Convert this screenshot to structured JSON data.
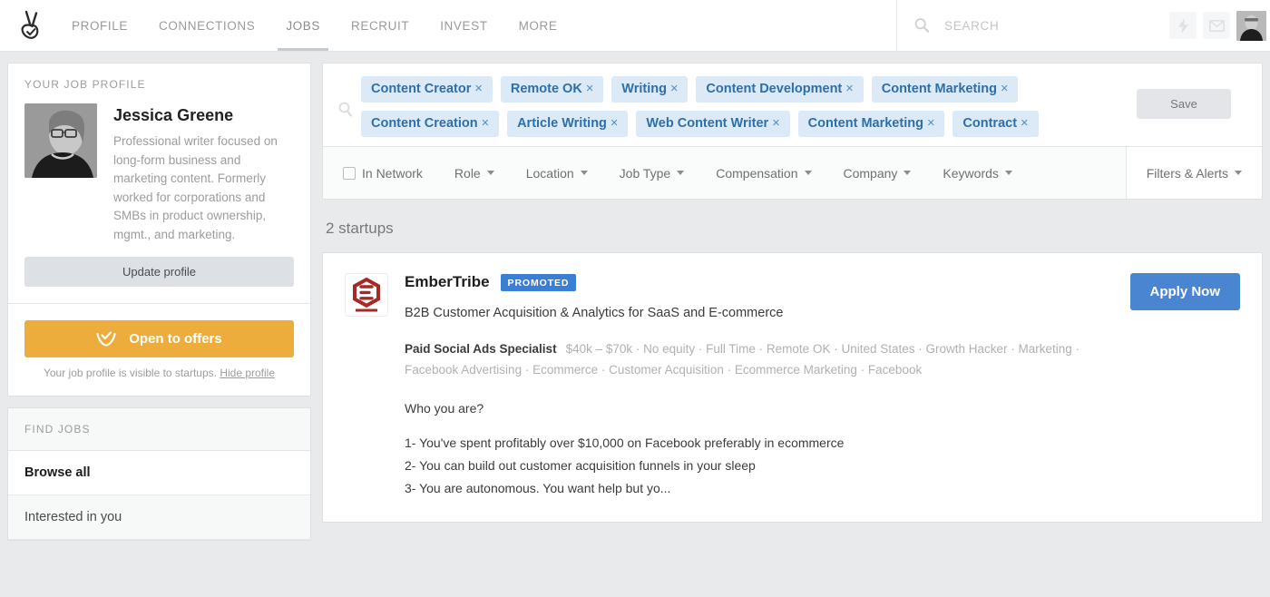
{
  "nav": {
    "logo_icon": "angellist-logo-icon",
    "items": [
      {
        "label": "PROFILE",
        "active": false
      },
      {
        "label": "CONNECTIONS",
        "active": false
      },
      {
        "label": "JOBS",
        "active": true
      },
      {
        "label": "RECRUIT",
        "active": false
      },
      {
        "label": "INVEST",
        "active": false
      },
      {
        "label": "MORE",
        "active": false
      }
    ],
    "search_placeholder": "SEARCH",
    "search_value": "",
    "search_icon": "search-icon",
    "bolt_icon": "lightning-bolt-icon",
    "mail_icon": "envelope-icon",
    "avatar": "user-avatar"
  },
  "sidebar": {
    "profile": {
      "kicker": "YOUR JOB PROFILE",
      "name": "Jessica Greene",
      "bio": "Professional writer focused on long-form business and marketing content. Formerly worked for corporations and SMBs in product ownership, mgmt., and marketing.",
      "update_label": "Update profile",
      "offers_label": "Open to offers",
      "offers_icon": "inbox-check-icon",
      "visibility_note": "Your job profile is visible to startups.",
      "hide_link": "Hide profile"
    },
    "find_jobs": {
      "heading": "FIND JOBS",
      "items": [
        {
          "label": "Browse all",
          "active": true
        },
        {
          "label": "Interested in you",
          "active": false
        }
      ]
    }
  },
  "search_panel": {
    "search_icon": "search-icon",
    "save_label": "Save",
    "tags": [
      "Content Creator",
      "Remote OK",
      "Writing",
      "Content Development",
      "Content Marketing",
      "Content Creation",
      "Article Writing",
      "Web Content Writer",
      "Content Marketing",
      "Contract"
    ],
    "tag_remove_glyph": "×"
  },
  "filters": {
    "in_network_label": "In Network",
    "in_network_checked": false,
    "dropdowns": [
      "Role",
      "Location",
      "Job Type",
      "Compensation",
      "Company",
      "Keywords"
    ],
    "right_label": "Filters & Alerts"
  },
  "results": {
    "count_label": "2 startups",
    "jobs": [
      {
        "company": "EmberTribe",
        "badge": "PROMOTED",
        "logo_icon": "embertribe-hexagon-logo",
        "tagline": "B2B Customer Acquisition & Analytics for SaaS and E-commerce",
        "role": "Paid Social Ads Specialist",
        "meta": "$40k – $70k · No equity · Full Time · Remote OK · United States · Growth Hacker · Marketing · Facebook Advertising · Ecommerce · Customer Acquisition · Ecommerce Marketing · Facebook",
        "desc_heading": "Who you are?",
        "desc_lines": [
          "1- You've spent profitably over $10,000 on Facebook preferably in ecommerce",
          "2- You can build out customer acquisition funnels in your sleep",
          "3- You are autonomous. You want help but yo..."
        ],
        "apply_label": "Apply Now"
      }
    ]
  },
  "colors": {
    "accent_blue": "#4a85d2",
    "tag_bg": "#dbeaf6",
    "tag_text": "#2e6fa8",
    "offers_orange": "#edad3c",
    "logo_red": "#a52a26",
    "page_bg": "#e9eaeb"
  }
}
